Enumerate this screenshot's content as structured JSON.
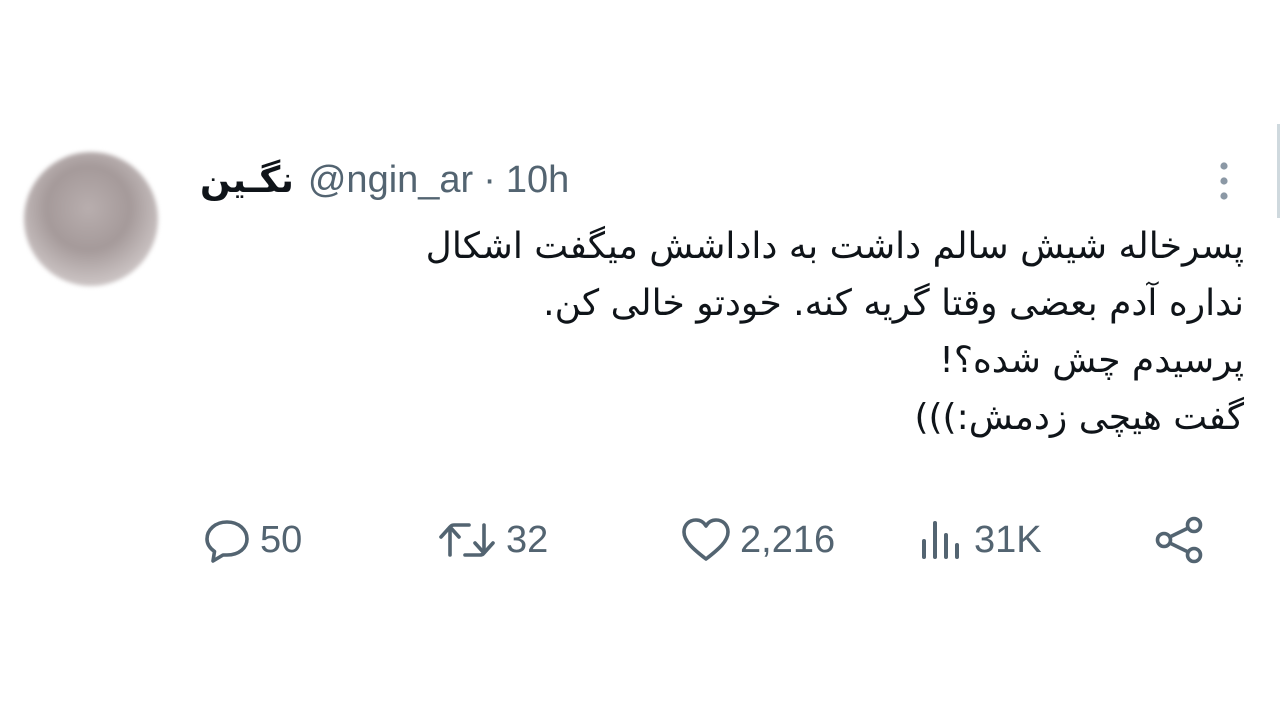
{
  "tweet": {
    "display_name": "نگـین",
    "handle": "@ngin_ar",
    "separator": "·",
    "time": "10h",
    "text_lines": [
      "پسرخاله شیش سالم داشت به داداشش میگفت اشکال",
      "نداره آدم بعضی وقتا گریه کنه. خودتو خالی کن.",
      "پرسیدم چش شده؟!",
      "گفت هیچی زدمش:)))"
    ]
  },
  "actions": {
    "replies": "50",
    "retweets": "32",
    "likes": "2,216",
    "views": "31K"
  },
  "icons": {
    "avatar": "blurred-avatar",
    "more": "more-vertical-icon",
    "reply": "reply-icon",
    "retweet": "retweet-icon",
    "like": "heart-icon",
    "views": "views-chart-icon",
    "share": "share-icon"
  },
  "colors": {
    "text_primary": "#0f1419",
    "text_secondary": "#536471",
    "background": "#ffffff"
  }
}
